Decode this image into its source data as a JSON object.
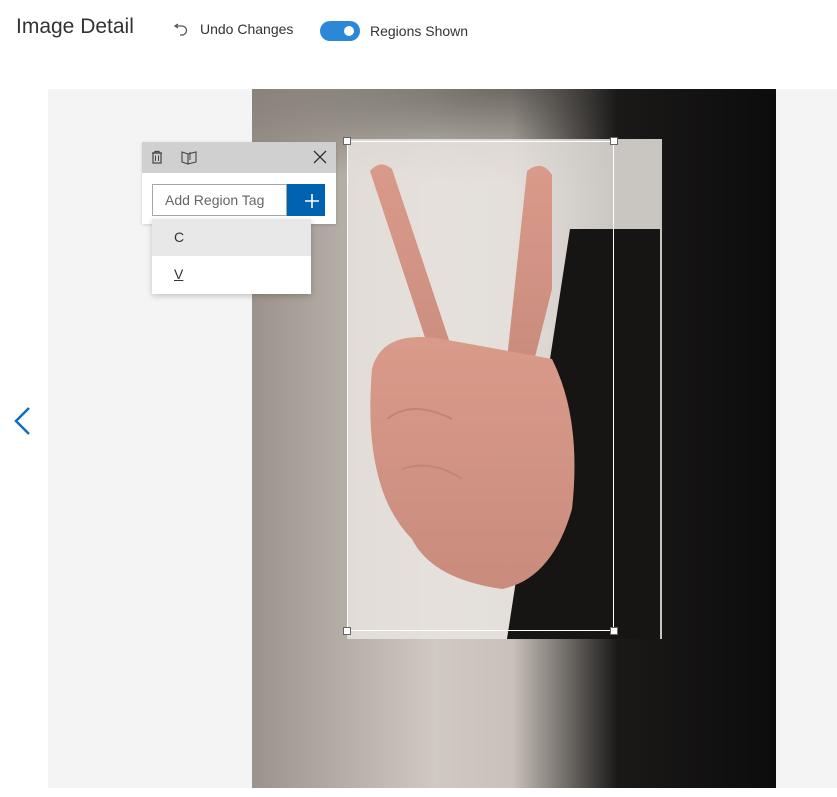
{
  "colors": {
    "accent": "#2b88d8",
    "brand": "#0063b1",
    "nav": "#106ebe"
  },
  "header": {
    "title": "Image Detail",
    "undo_label": "Undo Changes",
    "regions_toggle_label": "Regions Shown",
    "regions_toggle_on": true
  },
  "tag_editor": {
    "input_placeholder": "Add Region Tag",
    "input_value": "",
    "options": [
      {
        "label": "C",
        "highlighted": true
      },
      {
        "label": "V",
        "highlighted": false
      }
    ]
  },
  "icons": {
    "undo": "undo-icon",
    "delete": "trash-icon",
    "duplicate": "copy-region-icon",
    "close": "close-icon",
    "add": "plus-icon",
    "previous": "chevron-left-icon"
  }
}
